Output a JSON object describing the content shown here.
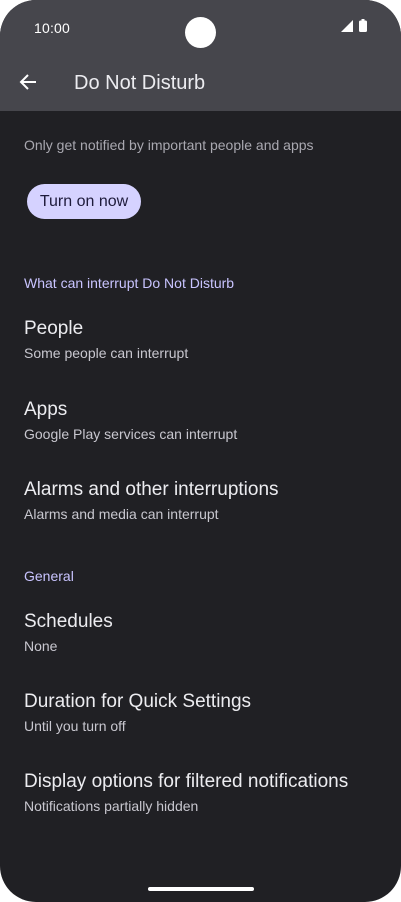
{
  "status_bar": {
    "time": "10:00",
    "icons": [
      "signal-icon",
      "battery-icon"
    ]
  },
  "header": {
    "back_icon": "arrow-back-icon",
    "title": "Do Not Disturb"
  },
  "intro": {
    "subtitle": "Only get notified by important people and apps",
    "turn_on_label": "Turn on now"
  },
  "sections": {
    "interrupt_header": "What can interrupt Do Not Disturb",
    "general_header": "General"
  },
  "items": [
    {
      "title": "People",
      "subtitle": "Some people can interrupt"
    },
    {
      "title": "Apps",
      "subtitle": "Google Play services can interrupt"
    },
    {
      "title": "Alarms and other interruptions",
      "subtitle": "Alarms and media can interrupt"
    },
    {
      "title": "Schedules",
      "subtitle": "None"
    },
    {
      "title": "Duration for Quick Settings",
      "subtitle": "Until you turn off"
    },
    {
      "title": "Display options for filtered notifications",
      "subtitle": "Notifications partially hidden"
    }
  ],
  "colors": {
    "background": "#202024",
    "top_bar": "#46464c",
    "accent": "#c9c4ff",
    "button": "#d5d2ff"
  }
}
